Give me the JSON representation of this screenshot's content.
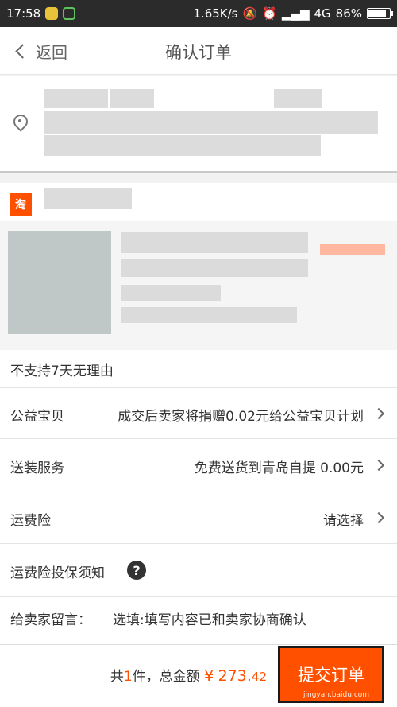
{
  "status_bar": {
    "time": "17:58",
    "network_speed": "1.65K/s",
    "network_type": "4G",
    "battery": "86%",
    "battery_level": 0.86
  },
  "nav": {
    "back_label": "返回",
    "title": "确认订单"
  },
  "shop": {
    "badge": "淘"
  },
  "product": {
    "return_policy": "不支持7天无理由"
  },
  "rows": {
    "charity": {
      "label": "公益宝贝",
      "value": "成交后卖家将捐赠0.02元给公益宝贝计划"
    },
    "delivery": {
      "label": "送装服务",
      "value": "免费送货到青岛自提 0.00元"
    },
    "shipping_insurance": {
      "label": "运费险",
      "value": "请选择"
    },
    "insurance_notice": {
      "label": "运费险投保须知",
      "help": "?"
    },
    "message": {
      "label": "给卖家留言：",
      "placeholder": "选填:填写内容已和卖家协商确认"
    }
  },
  "footer": {
    "total_prefix": "共",
    "count": "1",
    "total_middle": "件，总金额",
    "currency": "¥",
    "amount_main": "273.",
    "amount_decimal": "42",
    "submit_label": "提交订单"
  },
  "watermark": "jingyan.baidu.com",
  "colors": {
    "accent": "#ff5000",
    "status_bar": "#2b2b2b"
  }
}
